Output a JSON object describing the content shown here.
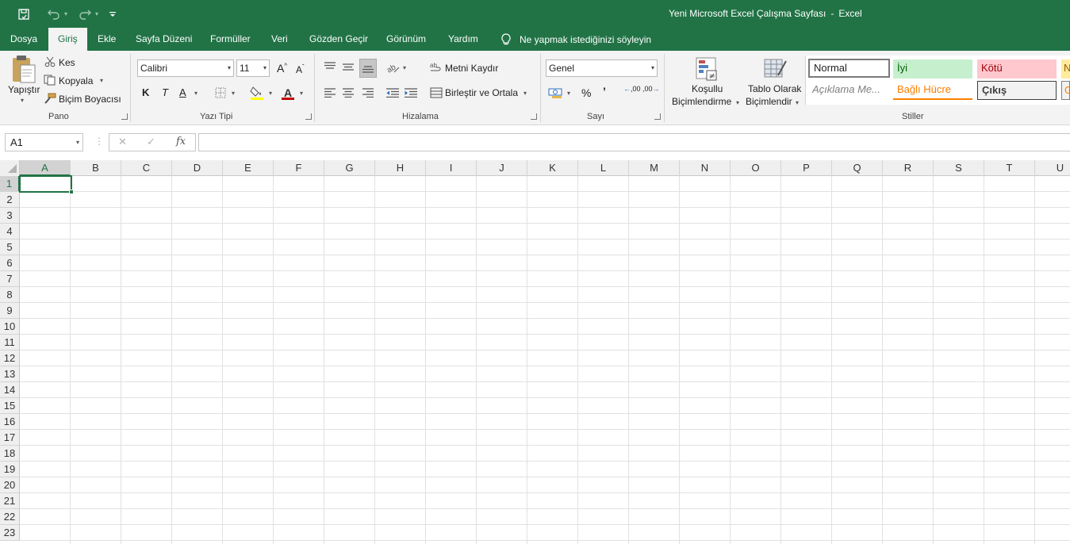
{
  "window": {
    "title": "Yeni Microsoft Excel Çalışma Sayfası",
    "separator": "-",
    "app": "Excel"
  },
  "colors": {
    "accent": "#217346",
    "good_bg": "#c6efce",
    "good_fg": "#006100",
    "bad_bg": "#ffc7ce",
    "bad_fg": "#9c0006",
    "neutral_bg": "#ffeb9c"
  },
  "tabs": [
    "Dosya",
    "Giriş",
    "Ekle",
    "Sayfa Düzeni",
    "Formüller",
    "Veri",
    "Gözden Geçir",
    "Görünüm",
    "Yardım"
  ],
  "active_tab": "Giriş",
  "tell_me": "Ne yapmak istediğinizi söyleyin",
  "clipboard": {
    "paste": "Yapıştır",
    "cut": "Kes",
    "copy": "Kopyala",
    "format_painter": "Biçim Boyacısı",
    "label": "Pano"
  },
  "font": {
    "name": "Calibri",
    "size": "11",
    "grow": "A",
    "shrink": "A",
    "bold": "K",
    "italic": "T",
    "underline": "A",
    "color_letter": "A",
    "label": "Yazı Tipi"
  },
  "alignment": {
    "wrap_text": "Metni Kaydır",
    "merge_center": "Birleştir ve Ortala",
    "label": "Hizalama"
  },
  "number": {
    "format": "Genel",
    "percent": "%",
    "comma": "’",
    "inc_decimal": ",00",
    "dec_decimal": ",00",
    "label": "Sayı"
  },
  "styles": {
    "conditional_line1": "Koşullu",
    "conditional_line2": "Biçimlendirme",
    "table_line1": "Tablo Olarak",
    "table_line2": "Biçimlendir",
    "cells": [
      "Normal",
      "İyi",
      "Kötü",
      "N",
      "Açıklama Me...",
      "Bağlı Hücre",
      "Çıkış",
      "G"
    ],
    "label": "Stiller"
  },
  "formula_bar": {
    "name_box": "A1",
    "cancel": "✕",
    "enter": "✓",
    "fx": "fx",
    "value": ""
  },
  "sheet": {
    "columns": [
      "A",
      "B",
      "C",
      "D",
      "E",
      "F",
      "G",
      "H",
      "I",
      "J",
      "K",
      "L",
      "M",
      "N",
      "O",
      "P",
      "Q",
      "R",
      "S",
      "T",
      "U"
    ],
    "rows": [
      "1",
      "2",
      "3",
      "4",
      "5",
      "6",
      "7",
      "8",
      "9",
      "10",
      "11",
      "12",
      "13",
      "14",
      "15",
      "16",
      "17",
      "18",
      "19",
      "20",
      "21",
      "22",
      "23"
    ],
    "active_cell": "A1"
  }
}
